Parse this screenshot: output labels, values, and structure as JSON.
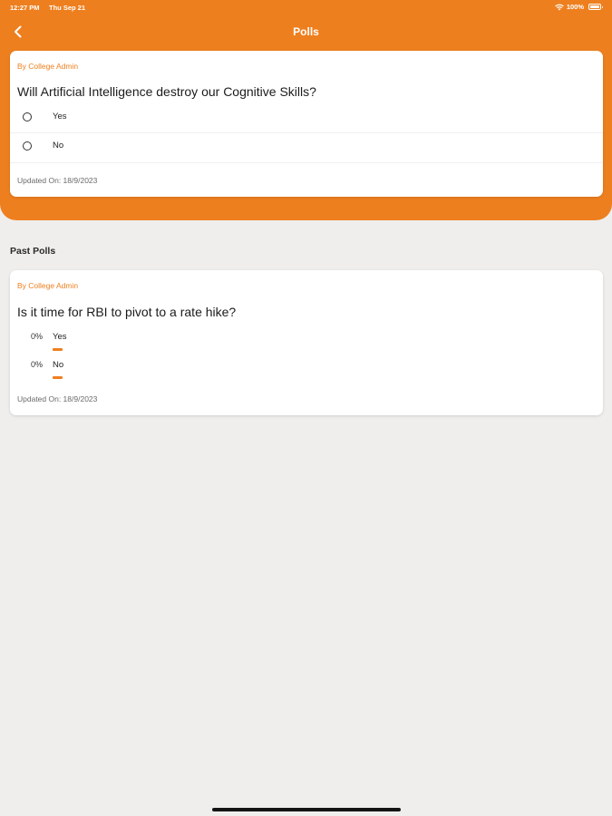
{
  "status_bar": {
    "time": "12:27 PM",
    "date": "Thu Sep 21",
    "battery": "100%",
    "wifi_icon": "wifi-icon",
    "battery_icon": "battery-icon"
  },
  "header": {
    "title": "Polls",
    "back_icon": "chevron-left-icon",
    "color": "#ee7f1f"
  },
  "current_poll": {
    "author": "By College Admin",
    "question": "Will Artificial Intelligence destroy our Cognitive Skills?",
    "options": [
      {
        "label": "Yes"
      },
      {
        "label": "No"
      }
    ],
    "updated": "Updated On: 18/9/2023"
  },
  "past_polls": {
    "section_title": "Past Polls",
    "items": [
      {
        "author": "By College Admin",
        "question": "Is it time for RBI to pivot to a rate hike?",
        "results": [
          {
            "percent": "0%",
            "label": "Yes",
            "value": 0
          },
          {
            "percent": "0%",
            "label": "No",
            "value": 0
          }
        ],
        "updated": "Updated On: 18/9/2023"
      }
    ]
  }
}
